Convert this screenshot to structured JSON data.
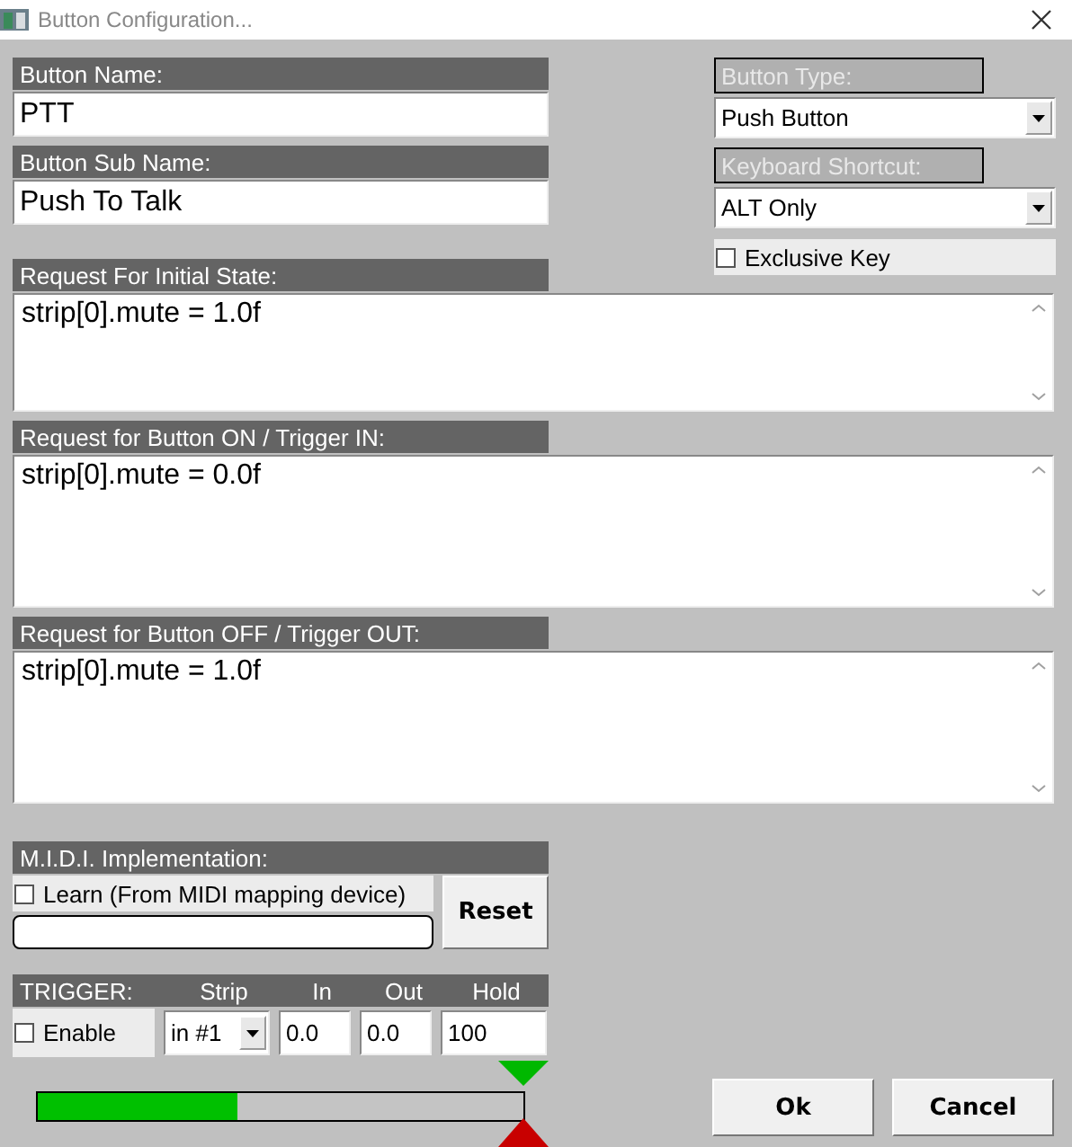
{
  "window": {
    "title": "Button Configuration..."
  },
  "button_name": {
    "label": "Button Name:",
    "value": "PTT"
  },
  "button_sub_name": {
    "label": "Button Sub Name:",
    "value": "Push To Talk"
  },
  "button_type": {
    "label": "Button Type:",
    "value": "Push Button"
  },
  "keyboard_shortcut": {
    "label": "Keyboard Shortcut:",
    "value": "ALT Only"
  },
  "exclusive_key": {
    "label": "Exclusive Key",
    "checked": false
  },
  "requests": [
    {
      "label": "Request For Initial State:",
      "value": "strip[0].mute = 1.0f"
    },
    {
      "label": "Request for Button ON / Trigger IN:",
      "value": "strip[0].mute = 0.0f"
    },
    {
      "label": "Request for Button OFF / Trigger OUT:",
      "value": "strip[0].mute = 1.0f"
    }
  ],
  "midi": {
    "label": "M.I.D.I. Implementation:",
    "learn": {
      "label": "Learn (From MIDI mapping device)",
      "checked": false
    },
    "reset": "Reset"
  },
  "trigger": {
    "label": "TRIGGER:",
    "columns": [
      "Strip",
      "In",
      "Out",
      "Hold"
    ],
    "enable": {
      "label": "Enable",
      "checked": false
    },
    "strip": "in #1",
    "in": "0.0",
    "out": "0.0",
    "hold": "100"
  },
  "meter": {
    "level": 0.41
  },
  "buttons": [
    "Ok",
    "Cancel"
  ]
}
